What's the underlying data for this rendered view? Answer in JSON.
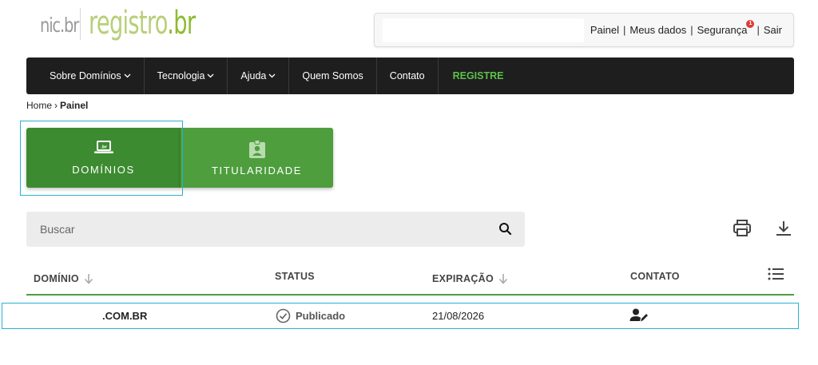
{
  "logo": {
    "nicbr": "nic.br",
    "registro": "registro",
    "dot": ".",
    "br": "br"
  },
  "user_nav": {
    "items": [
      {
        "label": "Painel"
      },
      {
        "label": "Meus dados"
      },
      {
        "label": "Segurança",
        "badge": "1"
      },
      {
        "label": "Sair"
      }
    ],
    "separator": "|"
  },
  "main_nav": {
    "items": [
      {
        "label": "Sobre Domínios",
        "dropdown": true
      },
      {
        "label": "Tecnologia",
        "dropdown": true
      },
      {
        "label": "Ajuda",
        "dropdown": true
      },
      {
        "label": "Quem Somos",
        "dropdown": false
      },
      {
        "label": "Contato",
        "dropdown": false
      },
      {
        "label": "REGISTRE",
        "dropdown": false
      }
    ],
    "chevron": "⌄"
  },
  "breadcrumb": {
    "home": "Home",
    "separator": "›",
    "current": "Painel"
  },
  "tiles": {
    "dominios": {
      "label": "DOMÍNIOS",
      "icon": "laptop-icon",
      "color": "#3d8b30"
    },
    "titularidade": {
      "label": "TITULARIDADE",
      "icon": "badge-icon",
      "color": "#4e9e3e"
    }
  },
  "search": {
    "placeholder": "Buscar",
    "value": ""
  },
  "toolbar": {
    "print_icon": "print-icon",
    "download_icon": "download-icon"
  },
  "table": {
    "columns": [
      {
        "label": "DOMÍNIO",
        "sortable": true
      },
      {
        "label": "STATUS",
        "sortable": false
      },
      {
        "label": "EXPIRAÇÃO",
        "sortable": true
      },
      {
        "label": "CONTATO",
        "sortable": false
      }
    ],
    "rows": [
      {
        "domain": ".COM.BR",
        "status": "Publicado",
        "expiration": "21/08/2026",
        "contact_icon": "contact-edit-icon"
      }
    ]
  },
  "colors": {
    "accent_green": "#4e9e3e",
    "dark_green": "#3d8b30",
    "nav_bg": "#1e1e1e",
    "registre_green": "#5cc04a",
    "focus": "#29b0d1",
    "badge_red": "#e03a3a"
  }
}
